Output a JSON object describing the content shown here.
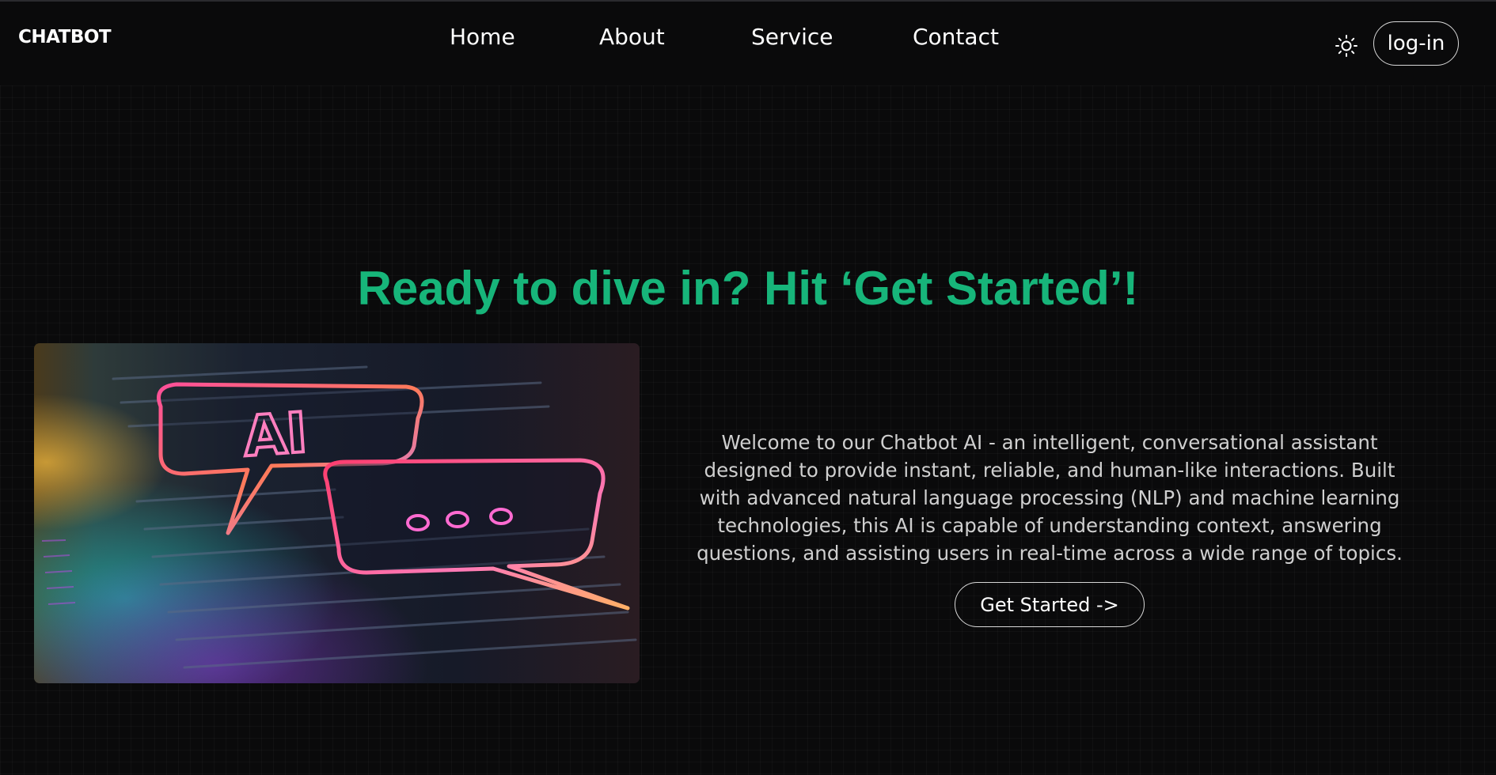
{
  "navbar": {
    "logo": "CHATBOT",
    "links": [
      {
        "label": "Home"
      },
      {
        "label": "About"
      },
      {
        "label": "Service"
      },
      {
        "label": "Contact"
      }
    ],
    "theme_icon": "sun-icon",
    "login_label": "log-in"
  },
  "hero": {
    "title": "Ready to dive in? Hit ‘Get Started’!",
    "image_icon": "chatbot-ai-illustration",
    "image_text": "AI",
    "description": "Welcome to our Chatbot AI - an intelligent, conversational assistant designed to provide instant, reliable, and human-like interactions. Built with advanced natural language processing (NLP) and machine learning technologies, this AI is capable of understanding context, answering questions, and assisting users in real-time across a wide range of topics.",
    "cta_label": "Get Started ->"
  },
  "colors": {
    "background": "#0a0a0b",
    "accent": "#17b57a",
    "text": "#ffffff",
    "muted_text": "#cfcfcf"
  }
}
